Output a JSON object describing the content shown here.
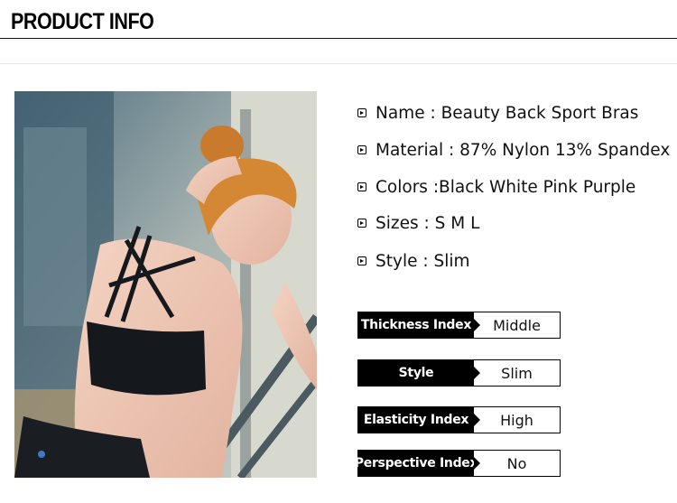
{
  "header": {
    "title": "PRODUCT INFO"
  },
  "photo": {
    "description_icon": "product-photo"
  },
  "specs": [
    {
      "label": "Name : Beauty Back Sport Bras"
    },
    {
      "label": "Material : 87% Nylon 13% Spandex"
    },
    {
      "label": "Colors :Black White Pink Purple"
    },
    {
      "label": "Sizes : S M L"
    },
    {
      "label": "Style : Slim"
    }
  ],
  "indexes": [
    {
      "label": "Thickness Index",
      "value": "Middle"
    },
    {
      "label": "Style",
      "value": "Slim"
    },
    {
      "label": "Elasticity Index",
      "value": "High"
    },
    {
      "label": "Perspective Index",
      "value": "No"
    }
  ],
  "colors": {
    "accent": "#000000",
    "label_text": "#ffffff",
    "page_bg": "#ffffff"
  }
}
